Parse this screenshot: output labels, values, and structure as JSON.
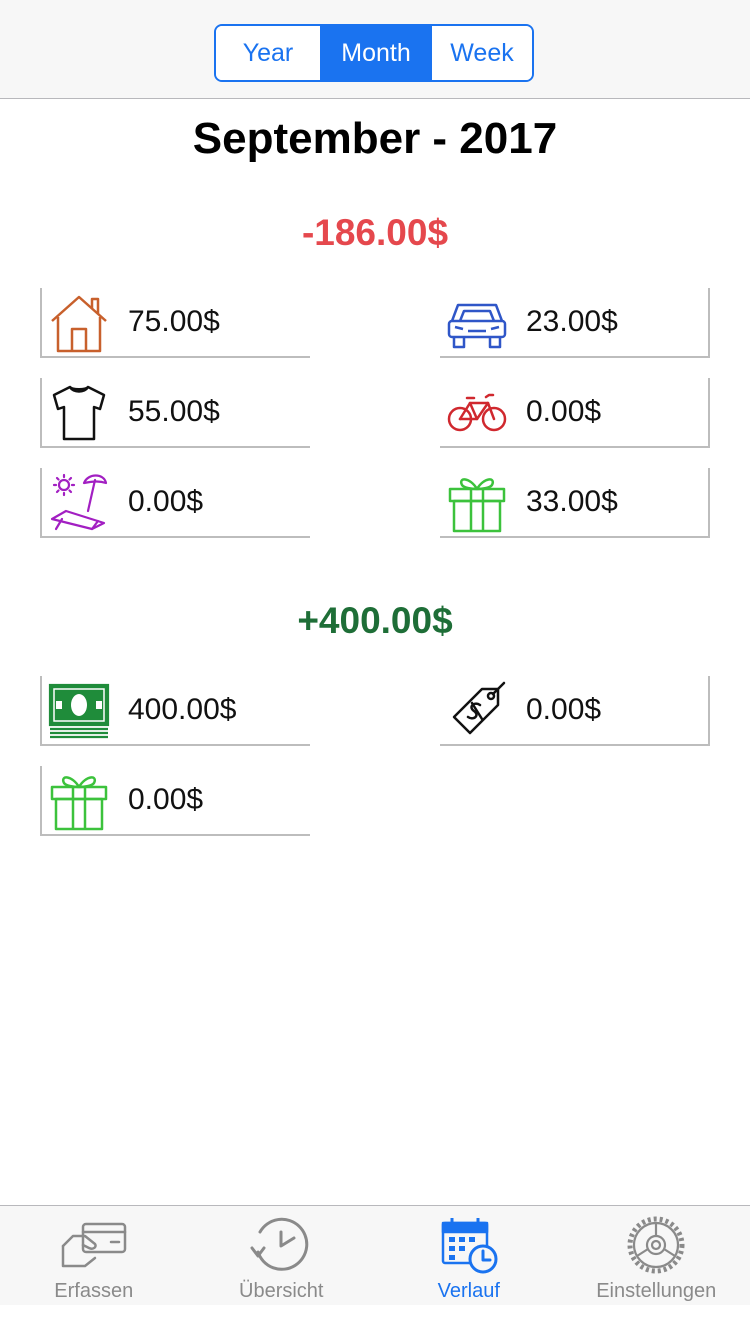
{
  "segmented": {
    "year": "Year",
    "month": "Month",
    "week": "Week",
    "selected": "Month"
  },
  "period": {
    "title": "September - 2017"
  },
  "expenses": {
    "total": "-186.00$",
    "color": "#e5484d",
    "items": [
      {
        "icon": "house-icon",
        "amount": "75.00$",
        "color": "#c8602c"
      },
      {
        "icon": "car-icon",
        "amount": "23.00$",
        "color": "#2f56c8"
      },
      {
        "icon": "tshirt-icon",
        "amount": "55.00$",
        "color": "#111111"
      },
      {
        "icon": "bicycle-icon",
        "amount": "0.00$",
        "color": "#d0282e"
      },
      {
        "icon": "beach-icon",
        "amount": "0.00$",
        "color": "#a21fc2"
      },
      {
        "icon": "gift-icon",
        "amount": "33.00$",
        "color": "#3cc23c"
      }
    ]
  },
  "income": {
    "total": "+400.00$",
    "color": "#1e6e37",
    "items": [
      {
        "icon": "money-icon",
        "amount": "400.00$",
        "color": "#1f8c3a"
      },
      {
        "icon": "price-tag-icon",
        "amount": "0.00$",
        "color": "#111111"
      },
      {
        "icon": "gift-icon",
        "amount": "0.00$",
        "color": "#3cc23c"
      }
    ]
  },
  "tabs": [
    {
      "label": "Erfassen",
      "icon": "card-payment-icon",
      "active": false
    },
    {
      "label": "Übersicht",
      "icon": "clock-history-icon",
      "active": false
    },
    {
      "label": "Verlauf",
      "icon": "calendar-clock-icon",
      "active": true
    },
    {
      "label": "Einstellungen",
      "icon": "gear-icon",
      "active": false
    }
  ],
  "accent": "#1a73f0"
}
